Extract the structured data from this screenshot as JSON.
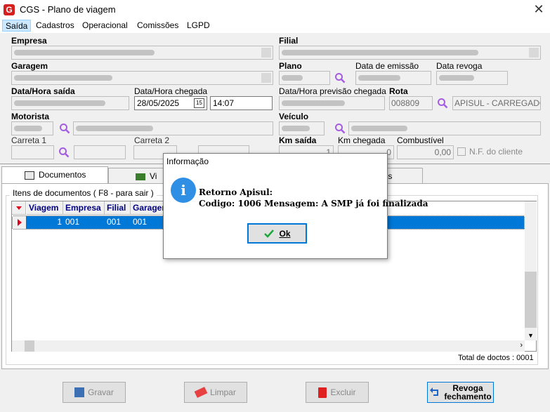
{
  "window": {
    "title": "CGS - Plano de viagem",
    "close": "✕",
    "logo": "G"
  },
  "menu": [
    "Saída",
    "Cadastros",
    "Operacional",
    "Comissões",
    "LGPD"
  ],
  "form": {
    "empresa_label": "Empresa",
    "filial_label": "Filial",
    "garagem_label": "Garagem",
    "plano_label": "Plano",
    "data_emissao_label": "Data de emissão",
    "data_revoga_label": "Data revoga",
    "data_hora_saida_label": "Data/Hora saída",
    "data_hora_chegada_label": "Data/Hora chegada",
    "data_chegada_value": "28/05/2025",
    "hora_chegada_value": "14:07",
    "previsao_label": "Data/Hora previsão chegada",
    "rota_label": "Rota",
    "rota_code": "008809",
    "rota_name": "APISUL - CARREGADO -",
    "motorista_label": "Motorista",
    "veiculo_label": "Veículo",
    "carreta1_label": "Carreta 1",
    "carreta2_label": "Carreta 2",
    "km_saida_label": "Km saída",
    "km_chegada_label": "Km chegada",
    "combustivel_label": "Combustível",
    "combustivel_value": "0,00",
    "km_chegada_value": "0",
    "km_saida_value": "1",
    "nf_cliente_label": "N.F. do cliente"
  },
  "tabs": [
    "Documentos",
    "Vi",
    "ões"
  ],
  "documents": {
    "group_title": "Itens de documentos ( F8 - para sair )",
    "columns": [
      "Viagem",
      "Empresa",
      "Filial",
      "Garagem"
    ],
    "rows": [
      {
        "viagem": "1",
        "empresa": "001",
        "filial": "001",
        "garagem": "001"
      }
    ],
    "total": "Total de doctos : 0001"
  },
  "buttons": {
    "gravar": "Gravar",
    "limpar": "Limpar",
    "excluir": "Excluir",
    "revoga1": "Revoga",
    "revoga2": "fechamento"
  },
  "dialog": {
    "title": "Informação",
    "line1": "Retorno Apisul:",
    "line2": "Codigo: 1006 Mensagem: A SMP já foi finalizada",
    "ok": "Ok",
    "icon": "i"
  },
  "colors": {
    "accent": "#0078d7",
    "logo": "#d4201f",
    "info": "#2f8fe5"
  }
}
